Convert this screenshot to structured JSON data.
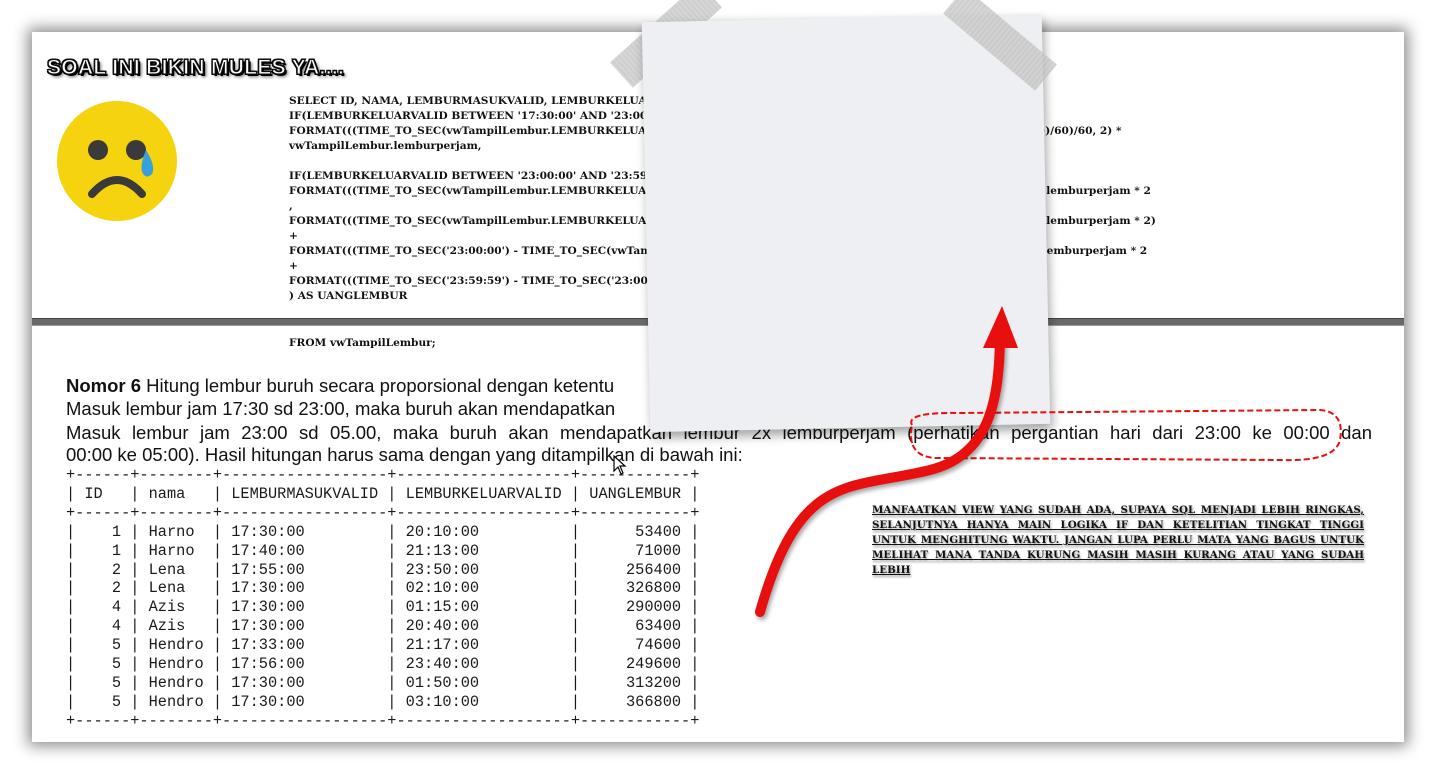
{
  "banner": "SOAL INI BIKIN MULES YA....",
  "sql_query": "SELECT ID, NAMA, LEMBURMASUKVALID, LEMBURKELUARVALID,\nIF(LEMBURKELUARVALID BETWEEN '17:30:00' AND '23:00:00',\nFORMAT(((TIME_TO_SEC(vwTampilLembur.LEMBURKELUARVALID) - TIME_TO_SEC(vwTampilLembur.LEMBURMASUKVALID))/60)/60, 2) *\nvwTampilLembur.lemburperjam,\n\nIF(LEMBURKELUARVALID BETWEEN '23:00:00' AND '23:59:59',\nFORMAT(((TIME_TO_SEC(vwTampilLembur.LEMBURKELUARVALID) - TIME_TO_SEC('23:00:00'))/60)/60, 2) * vwTampilLembur.lemburperjam * 2\n,\nFORMAT(((TIME_TO_SEC(vwTampilLembur.LEMBURKELUARVALID) - TIME_TO_SEC('00:00:00'))/60)/60, 2) * vwTampilLembur.lemburperjam * 2)\n+\nFORMAT(((TIME_TO_SEC('23:00:00') - TIME_TO_SEC(vwTampilLembur.LEMBURMASUKVALID))/60)/60, 2) * vwTampilLembur.lemburperjam * 2\n+\nFORMAT(((TIME_TO_SEC('23:59:59') - TIME_TO_SEC('23:00:00'))/60)/60, 2) * vwTampilLembur.lemburperjam\n) AS UANGLEMBUR",
  "sql_from": "FROM vwTampilLembur;",
  "question": {
    "label": "Nomor 6",
    "line1": " Hitung lembur buruh secara proporsional dengan ketentu",
    "line2": "Masuk lembur jam 17:30 sd 23:00, maka buruh akan mendapatkan",
    "line3": "Masuk lembur jam 23:00 sd 05.00, maka buruh akan mendapatkan lembur 2x lemburperjam (perhatikan pergantian hari dari 23:00 ke 00:00 dan",
    "line4": "00:00 ke 05:00). Hasil hitungan harus sama dengan yang ditampilkan di bawah ini:"
  },
  "result_table": {
    "border": "+------+--------+------------------+-------------------+------------+",
    "headers": [
      "ID",
      "nama",
      "LEMBURMASUKVALID",
      "LEMBURKELUARVALID",
      "UANGLEMBUR"
    ],
    "rows": [
      [
        "1",
        "Harno",
        "17:30:00",
        "20:10:00",
        "53400"
      ],
      [
        "1",
        "Harno",
        "17:40:00",
        "21:13:00",
        "71000"
      ],
      [
        "2",
        "Lena",
        "17:55:00",
        "23:50:00",
        "256400"
      ],
      [
        "2",
        "Lena",
        "17:30:00",
        "02:10:00",
        "326800"
      ],
      [
        "4",
        "Azis",
        "17:30:00",
        "01:15:00",
        "290000"
      ],
      [
        "4",
        "Azis",
        "17:30:00",
        "20:40:00",
        "63400"
      ],
      [
        "5",
        "Hendro",
        "17:33:00",
        "21:17:00",
        "74600"
      ],
      [
        "5",
        "Hendro",
        "17:56:00",
        "23:40:00",
        "249600"
      ],
      [
        "5",
        "Hendro",
        "17:30:00",
        "01:50:00",
        "313200"
      ],
      [
        "5",
        "Hendro",
        "17:30:00",
        "03:10:00",
        "366800"
      ]
    ]
  },
  "hint_note": "MANFAATKAN VIEW YANG SUDAH ADA, SUPAYA SQL MENJADI LEBIH RINGKAS, SELANJUTNYA HANYA MAIN LOGIKA IF DAN KETELITIAN TINGKAT TINGGI UNTUK MENGHITUNG WAKTU. JANGAN LUPA PERLU MATA YANG BAGUS UNTUK MELIHAT MANA TANDA KURUNG MASIH MASIH KURANG ATAU YANG SUDAH LEBIH",
  "icons": {
    "emoji": "crying-face-icon",
    "arrow": "red-curved-arrow-icon",
    "cursor": "mouse-pointer-icon"
  },
  "colors": {
    "emoji_yellow": "#f5d40f",
    "emoji_dark": "#3a3a3a",
    "tear_blue": "#3aa0dc",
    "arrow_red": "#e80f0f",
    "divider_gray": "#6a6a6a"
  }
}
